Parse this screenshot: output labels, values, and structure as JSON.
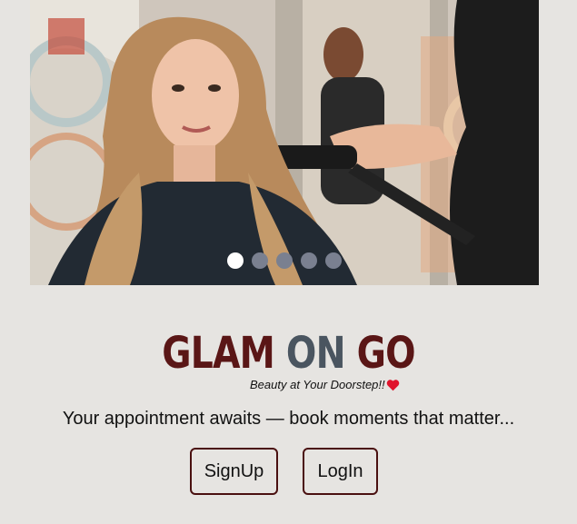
{
  "hero": {
    "image": "salon-woman-hair-straightening-photo",
    "slides_total": 5,
    "active_slide": 1
  },
  "brand": {
    "logo_part1": "GLAM",
    "logo_part2": "ON",
    "logo_part3": "GO",
    "tagline": "Beauty at Your Doorstep!!",
    "tagline_icon": "heart-icon",
    "color_primary": "#5a1616",
    "color_secondary": "#4a5560"
  },
  "subtitle": "Your appointment awaits — book moments that matter...",
  "buttons": {
    "signup_label": "SignUp",
    "login_label": "LogIn"
  }
}
